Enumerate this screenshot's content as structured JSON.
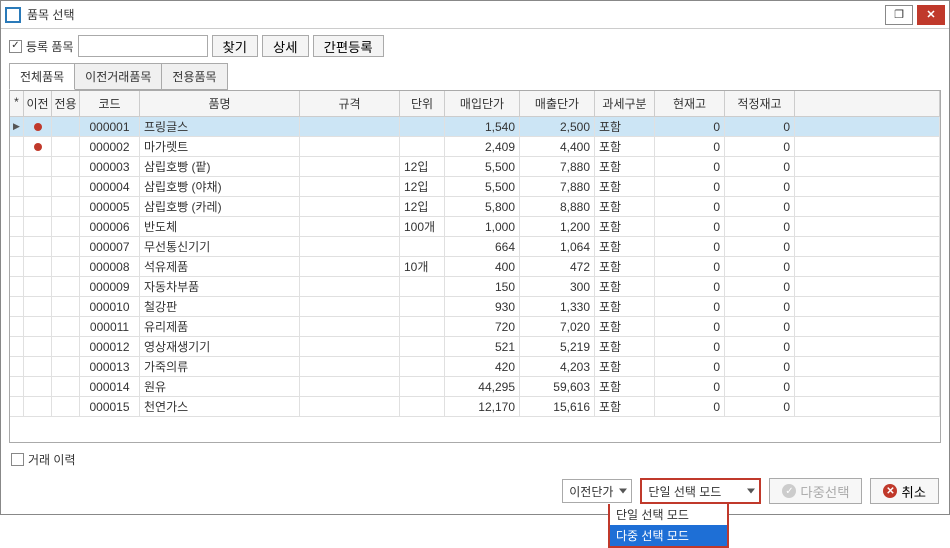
{
  "window": {
    "title": "품목 선택"
  },
  "toolbar": {
    "registered_label": "등록 품목",
    "search_btn": "찾기",
    "detail_btn": "상세",
    "quick_reg_btn": "간편등록"
  },
  "tabs": [
    {
      "label": "전체품목",
      "active": true
    },
    {
      "label": "이전거래품목",
      "active": false
    },
    {
      "label": "전용품목",
      "active": false
    }
  ],
  "columns": {
    "mark": "*",
    "prev": "이전",
    "excl": "전용",
    "code": "코드",
    "name": "품명",
    "spec": "규격",
    "unit": "단위",
    "buy": "매입단가",
    "sell": "매출단가",
    "tax": "과세구분",
    "stock": "현재고",
    "proper": "적정재고"
  },
  "rows": [
    {
      "prev_dot": true,
      "code": "000001",
      "name": "프링글스",
      "spec": "",
      "unit": "",
      "buy": "1,540",
      "sell": "2,500",
      "tax": "포함",
      "stock": "0",
      "proper": "0",
      "selected": true,
      "indicator": "▶"
    },
    {
      "prev_dot": true,
      "code": "000002",
      "name": "마가렛트",
      "spec": "",
      "unit": "",
      "buy": "2,409",
      "sell": "4,400",
      "tax": "포함",
      "stock": "0",
      "proper": "0"
    },
    {
      "prev_dot": false,
      "code": "000003",
      "name": "삼립호빵 (팥)",
      "spec": "",
      "unit": "12입",
      "buy": "5,500",
      "sell": "7,880",
      "tax": "포함",
      "stock": "0",
      "proper": "0"
    },
    {
      "prev_dot": false,
      "code": "000004",
      "name": "삼립호빵 (야채)",
      "spec": "",
      "unit": "12입",
      "buy": "5,500",
      "sell": "7,880",
      "tax": "포함",
      "stock": "0",
      "proper": "0"
    },
    {
      "prev_dot": false,
      "code": "000005",
      "name": "삼립호빵 (카레)",
      "spec": "",
      "unit": "12입",
      "buy": "5,800",
      "sell": "8,880",
      "tax": "포함",
      "stock": "0",
      "proper": "0"
    },
    {
      "prev_dot": false,
      "code": "000006",
      "name": "반도체",
      "spec": "",
      "unit": "100개",
      "buy": "1,000",
      "sell": "1,200",
      "tax": "포함",
      "stock": "0",
      "proper": "0"
    },
    {
      "prev_dot": false,
      "code": "000007",
      "name": "무선통신기기",
      "spec": "",
      "unit": "",
      "buy": "664",
      "sell": "1,064",
      "tax": "포함",
      "stock": "0",
      "proper": "0"
    },
    {
      "prev_dot": false,
      "code": "000008",
      "name": "석유제품",
      "spec": "",
      "unit": "10개",
      "buy": "400",
      "sell": "472",
      "tax": "포함",
      "stock": "0",
      "proper": "0"
    },
    {
      "prev_dot": false,
      "code": "000009",
      "name": "자동차부품",
      "spec": "",
      "unit": "",
      "buy": "150",
      "sell": "300",
      "tax": "포함",
      "stock": "0",
      "proper": "0"
    },
    {
      "prev_dot": false,
      "code": "000010",
      "name": "철강판",
      "spec": "",
      "unit": "",
      "buy": "930",
      "sell": "1,330",
      "tax": "포함",
      "stock": "0",
      "proper": "0"
    },
    {
      "prev_dot": false,
      "code": "000011",
      "name": "유리제품",
      "spec": "",
      "unit": "",
      "buy": "720",
      "sell": "7,020",
      "tax": "포함",
      "stock": "0",
      "proper": "0"
    },
    {
      "prev_dot": false,
      "code": "000012",
      "name": "영상재생기기",
      "spec": "",
      "unit": "",
      "buy": "521",
      "sell": "5,219",
      "tax": "포함",
      "stock": "0",
      "proper": "0"
    },
    {
      "prev_dot": false,
      "code": "000013",
      "name": "가죽의류",
      "spec": "",
      "unit": "",
      "buy": "420",
      "sell": "4,203",
      "tax": "포함",
      "stock": "0",
      "proper": "0"
    },
    {
      "prev_dot": false,
      "code": "000014",
      "name": "원유",
      "spec": "",
      "unit": "",
      "buy": "44,295",
      "sell": "59,603",
      "tax": "포함",
      "stock": "0",
      "proper": "0"
    },
    {
      "prev_dot": false,
      "code": "000015",
      "name": "천연가스",
      "spec": "",
      "unit": "",
      "buy": "12,170",
      "sell": "15,616",
      "tax": "포함",
      "stock": "0",
      "proper": "0"
    }
  ],
  "footer": {
    "history_label": "거래 이력",
    "prev_price_label": "이전단가",
    "mode_selected": "단일 선택 모드",
    "mode_options": [
      "단일 선택 모드",
      "다중 선택 모드"
    ],
    "multi_btn": "다중선택",
    "cancel_btn": "취소"
  }
}
